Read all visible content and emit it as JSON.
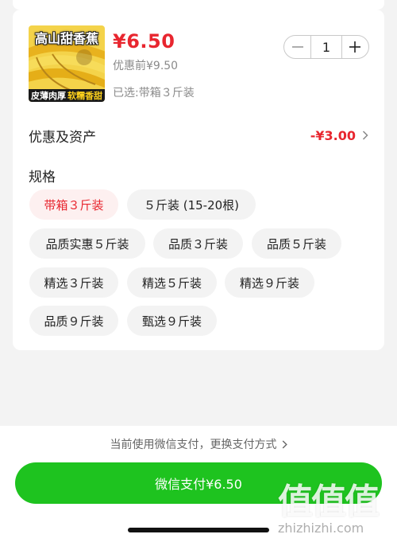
{
  "product": {
    "image_title": "高山甜香蕉",
    "image_caption_white": "皮薄肉厚",
    "image_caption_yellow": "软糯香甜",
    "price": "¥6.50",
    "pre_discount_price": "优惠前¥9.50",
    "selected_spec": "已选:带箱３斤装"
  },
  "stepper": {
    "quantity": "1"
  },
  "discount": {
    "label": "优惠及资产",
    "amount": "-¥3.00"
  },
  "specs": {
    "title": "规格",
    "options": [
      "带箱３斤装",
      "５斤装 (15-20根)",
      "品质实惠５斤装",
      "品质３斤装",
      "品质５斤装",
      "精选３斤装",
      "精选５斤装",
      "精选９斤装",
      "品质９斤装",
      "甄选９斤装"
    ],
    "selected_index": 0
  },
  "payment": {
    "hint": "当前使用微信支付，更换支付方式",
    "button_label": "微信支付¥6.50"
  },
  "watermark": {
    "glyphs": "值值值",
    "url": "zhizhizhi.com"
  },
  "colors": {
    "accent_red": "#e8262f",
    "pay_green": "#1ec31f",
    "chip_bg": "#f3f3f3",
    "chip_selected_bg": "#fdf0f0"
  },
  "icons": {
    "minus": "minus-icon",
    "plus": "plus-icon",
    "chevron": "chevron-right-icon"
  }
}
